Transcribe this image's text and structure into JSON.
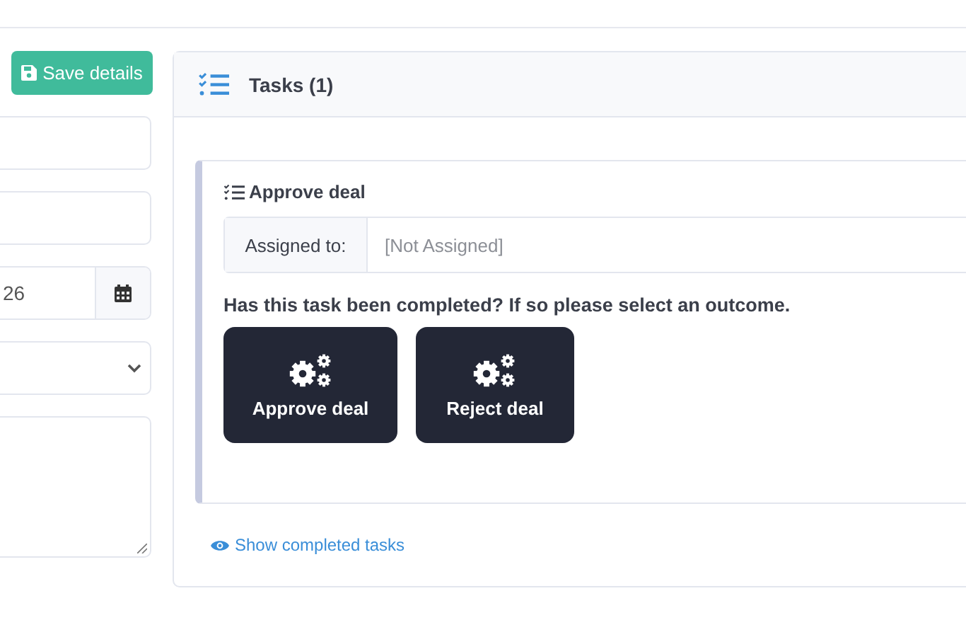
{
  "save_button": {
    "label": "Save details"
  },
  "form_fields": [
    {
      "kind": "text"
    },
    {
      "kind": "text"
    },
    {
      "kind": "date",
      "value": "26"
    },
    {
      "kind": "select"
    },
    {
      "kind": "textarea"
    }
  ],
  "tasks_panel": {
    "title": "Tasks (1)",
    "tasks": [
      {
        "title": "Approve deal",
        "assigned_label": "Assigned to:",
        "assigned_value": "[Not Assigned]",
        "question": "Has this task been completed? If so please select an outcome.",
        "outcomes": [
          "Approve deal",
          "Reject deal"
        ]
      }
    ],
    "show_completed_link": "Show completed tasks"
  }
}
